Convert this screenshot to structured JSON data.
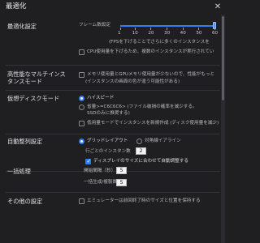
{
  "window": {
    "title": "最適化",
    "close_icon": "close-icon"
  },
  "sections": {
    "optimization": {
      "label": "最適化設定",
      "slider": {
        "name": "フレーム数設定",
        "value": 60,
        "ticks": [
          "1",
          "10",
          "20",
          "30",
          "40",
          "50",
          "60"
        ],
        "hint": "(FPSを下げることでさらに多くのインスタンスを",
        "scale_max": 60,
        "tick_values": [
          1,
          10,
          20,
          30,
          40,
          50,
          60
        ]
      },
      "cpu_checkbox": {
        "label": "CPU使用量を下げるため、複数のインスタンスが実行されてい",
        "checked": false
      }
    },
    "multi_instance": {
      "label_line1": "高性能なマルチインス",
      "label_line2": "タンスモード",
      "checkbox": {
        "label_line1": "メモリ使用量とGPUメモリ使用量が少ないので、性能がもっと",
        "label_line2": "(インスタンスの画面の色が違う可能性がある)",
        "checked": false
      }
    },
    "virtual_disk": {
      "label": "仮想ディスクモード",
      "radio_high_speed": {
        "label": "ハイスピード",
        "selected": true
      },
      "radio_save": {
        "label_line1": "省量>=C6C6C6> (ファイル破損の確率を減少する。",
        "label_line2": "SSDのみに推奨する)",
        "selected": false
      },
      "low_usage_checkbox": {
        "label": "低用量モードでインスタンスを新規作成 (ディスク使用量を減少)",
        "checked": false
      }
    },
    "auto_arrange": {
      "label": "自動整列設定",
      "radio_grid": {
        "label": "グリッドレイアウト",
        "selected": true
      },
      "radio_diagonal": {
        "label": "対角線イアライン",
        "selected": false
      },
      "per_row": {
        "label": "行ごとのインスタン数",
        "value": "2"
      },
      "display_checkbox": {
        "label": "ディスプレイのサイズに合わせて自動調整する",
        "checked": true
      }
    },
    "batch": {
      "label": "一括処理",
      "start_interval": {
        "label": "開始間隔（秒）",
        "value": "5"
      },
      "batch_count": {
        "label": "一括生成/複製数",
        "value": "5"
      }
    },
    "other": {
      "label": "その他の設定",
      "checkbox": {
        "label": "エミュレーターは前回終了時のサイズと位置を保持する",
        "checked": false
      }
    }
  },
  "colors": {
    "accent": "#2f7cf6",
    "background": "#1f1f22"
  }
}
